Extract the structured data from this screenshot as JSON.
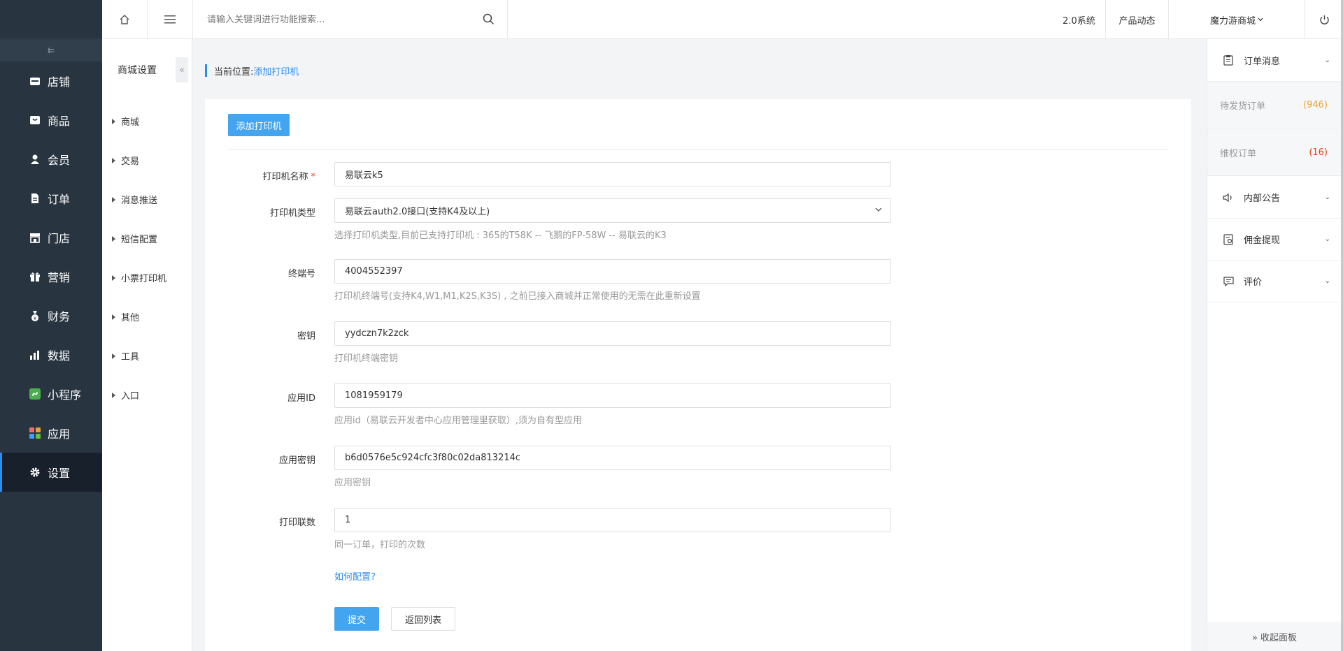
{
  "sidebar": {
    "items": [
      {
        "label": "店铺",
        "icon": "store-icon"
      },
      {
        "label": "商品",
        "icon": "goods-icon"
      },
      {
        "label": "会员",
        "icon": "member-icon"
      },
      {
        "label": "订单",
        "icon": "order-icon"
      },
      {
        "label": "门店",
        "icon": "shop-icon"
      },
      {
        "label": "营销",
        "icon": "gift-icon"
      },
      {
        "label": "财务",
        "icon": "finance-icon"
      },
      {
        "label": "数据",
        "icon": "chart-icon"
      },
      {
        "label": "小程序",
        "icon": "miniprogram-icon"
      },
      {
        "label": "应用",
        "icon": "apps-icon"
      },
      {
        "label": "设置",
        "icon": "gear-icon"
      }
    ],
    "active": "设置",
    "fold_glyph": "⇇"
  },
  "subnav": {
    "title": "商城设置",
    "collapse_glyph": "«",
    "items": [
      "商城",
      "交易",
      "消息推送",
      "短信配置",
      "小票打印机",
      "其他",
      "工具",
      "入口"
    ]
  },
  "topbar": {
    "search_placeholder": "请输入关键词进行功能搜索...",
    "version": "2.0系统",
    "news": "产品动态",
    "shop_name": "魔力游商城"
  },
  "breadcrumb": {
    "prefix": "当前位置:",
    "current": "添加打印机"
  },
  "form": {
    "add_button": "添加打印机",
    "fields": {
      "name": {
        "label": "打印机名称",
        "required": "*",
        "value": "易联云k5"
      },
      "type": {
        "label": "打印机类型",
        "value": "易联云auth2.0接口(支持K4及以上)",
        "help": "选择打印机类型,目前已支持打印机 : 365的T58K -- 飞鹅的FP-58W -- 易联云的K3"
      },
      "terminal": {
        "label": "终端号",
        "value": "4004552397",
        "help": "打印机终端号(支持K4,W1,M1,K2S,K3S) , 之前已接入商城并正常使用的无需在此重新设置"
      },
      "secret": {
        "label": "密钥",
        "value": "yydczn7k2zck",
        "help": "打印机终端密钥"
      },
      "app_id": {
        "label": "应用ID",
        "value": "1081959179",
        "help": "应用id（易联云开发者中心应用管理里获取）,须为自有型应用"
      },
      "app_secret": {
        "label": "应用密钥",
        "value": "b6d0576e5c924cfc3f80c02da813214c",
        "help": "应用密钥"
      },
      "copies": {
        "label": "打印联数",
        "value": "1",
        "help": "同一订单，打印的次数"
      }
    },
    "how_link": "如何配置?",
    "submit": "提交",
    "back": "返回列表"
  },
  "right_panel": {
    "order_msg": "订单消息",
    "pending_label": "待发货订单",
    "pending_count": "(946)",
    "rights_label": "维权订单",
    "rights_count": "(16)",
    "notice": "内部公告",
    "commission": "佣金提现",
    "review": "评价",
    "collapse": "» 收起面板"
  },
  "colors": {
    "accent": "#2d8cf0",
    "button": "#43a5ef",
    "sidebar_bg": "#283541",
    "pending": "#f0a030",
    "rights": "#ed4014"
  }
}
